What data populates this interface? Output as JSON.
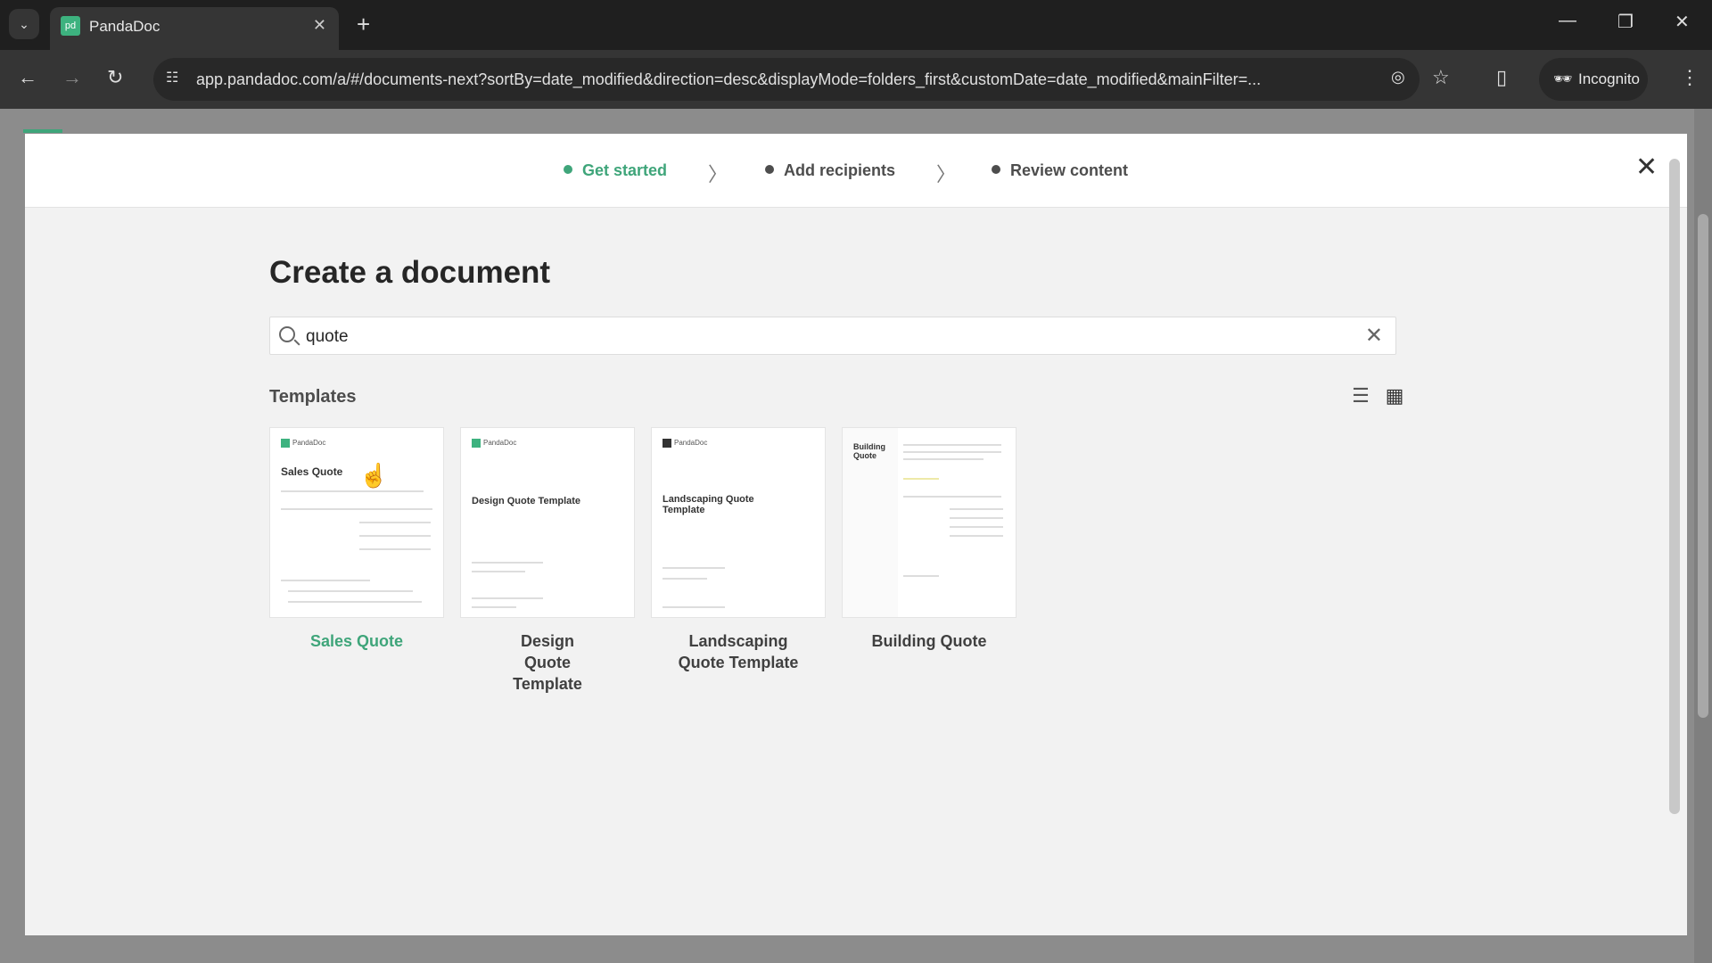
{
  "browser": {
    "tab_title": "PandaDoc",
    "favicon": "pd",
    "url": "app.pandadoc.com/a/#/documents-next?sortBy=date_modified&direction=desc&displayMode=folders_first&customDate=date_modified&mainFilter=...",
    "incognito_label": "Incognito"
  },
  "steps": [
    {
      "label": "Get started",
      "active": true
    },
    {
      "label": "Add recipients",
      "active": false
    },
    {
      "label": "Review content",
      "active": false
    }
  ],
  "title": "Create a document",
  "search": {
    "value": "quote"
  },
  "templates": {
    "heading": "Templates",
    "view_mode": "grid",
    "items": [
      {
        "name": "Sales Quote",
        "preview_title": "Sales Quote",
        "hovered": true
      },
      {
        "name": "Design Quote Template",
        "preview_title": "Design Quote Template"
      },
      {
        "name": "Landscaping Quote Template",
        "preview_title": "Landscaping Quote Template"
      },
      {
        "name": "Building Quote",
        "preview_title": "Building Quote"
      }
    ]
  },
  "colors": {
    "accent": "#3fa57a"
  }
}
